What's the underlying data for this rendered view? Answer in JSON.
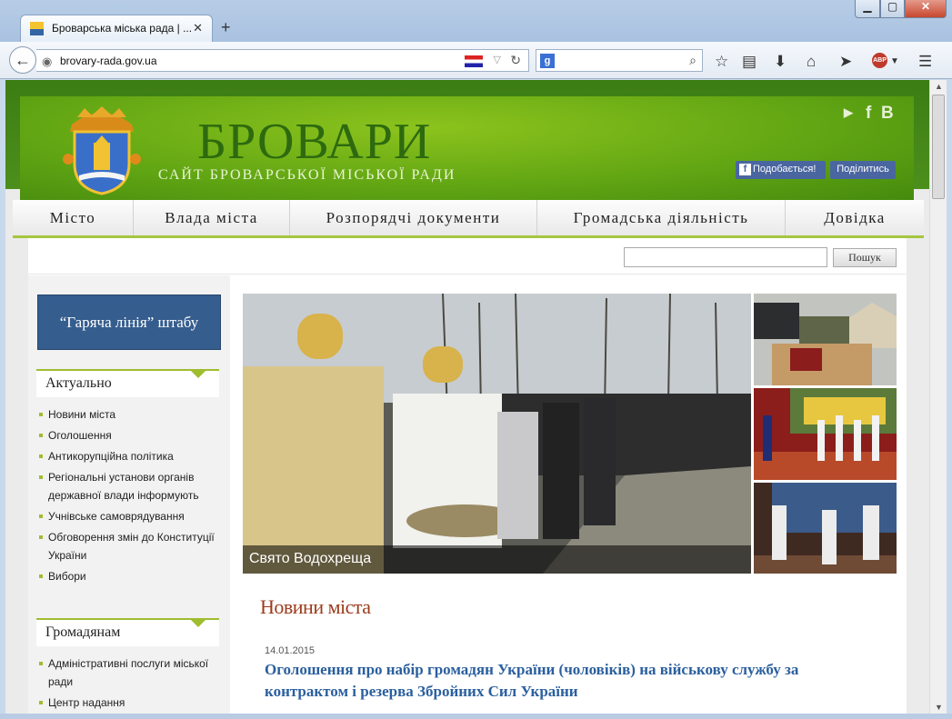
{
  "browser": {
    "tab_title": "Броварська міська рада | ...",
    "url": "brovary-rada.gov.ua",
    "new_tab": "+",
    "tab_close": "✕",
    "abp_label": "ABP"
  },
  "header": {
    "title": "БРОВАРИ",
    "subtitle": "САЙТ БРОВАРСЬКОЇ МІСЬКОЇ РАДИ",
    "social": [
      "youtube-icon",
      "facebook-icon",
      "vkontakte-icon"
    ],
    "fb_like_label": "Подобається!",
    "fb_share_label": "Поділитись"
  },
  "menu": {
    "items": [
      "Місто",
      "Влада міста",
      "Розпорядчі документи",
      "Громадська діяльність",
      "Довідка"
    ]
  },
  "search": {
    "button_label": "Пошук",
    "value": ""
  },
  "sidebar": {
    "hotline": "“Гаряча лінія” штабу",
    "sections": [
      {
        "title": "Актуально",
        "items": [
          "Новини міста",
          "Оголошення",
          "Антикорупційна політика",
          "Регіональні установи органів державної влади інформують",
          "Учнівське самоврядування",
          "Обговорення змін до Конституції України",
          "Вибори"
        ]
      },
      {
        "title": "Громадянам",
        "items": [
          "Адміністративні послуги міської ради",
          "Центр надання"
        ]
      }
    ]
  },
  "slider": {
    "caption": "Свято Водохреща"
  },
  "news": {
    "heading": "Новини міста",
    "items": [
      {
        "date": "14.01.2015",
        "title": "Оголошення про набір громадян України (чоловіків) на військову службу за контрактом і резерва Збройних Сил України"
      }
    ]
  },
  "colors": {
    "header_green": "#5fa413",
    "title_green": "#2d6a0f",
    "menu_accent": "#a6c63f",
    "hotline_blue": "#355d8e",
    "news_heading": "#9c3b1b",
    "news_link": "#2a5f9e"
  }
}
